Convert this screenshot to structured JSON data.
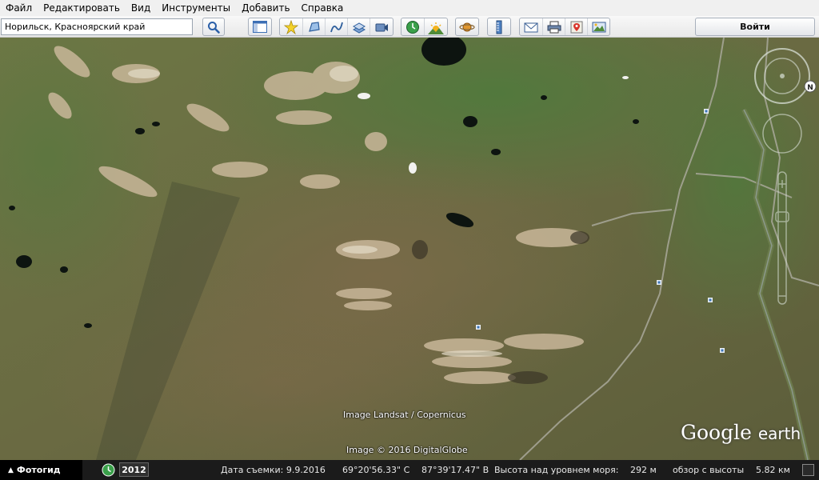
{
  "menu": {
    "items": [
      "Файл",
      "Редактировать",
      "Вид",
      "Инструменты",
      "Добавить",
      "Справка"
    ]
  },
  "toolbar": {
    "search_value": "Норильск, Красноярский край",
    "login_label": "Войти",
    "icons": [
      "search-icon",
      "sidebar-icon",
      "placemark-icon",
      "polygon-icon",
      "path-icon",
      "image-overlay-icon",
      "record-tour-icon",
      "historical-imagery-icon",
      "sunlight-icon",
      "planets-icon",
      "ruler-icon",
      "email-icon",
      "print-icon",
      "google-maps-icon",
      "save-image-icon"
    ]
  },
  "map": {
    "credit_landsat": "Image Landsat / Copernicus",
    "credit_globe": "Image © 2016 DigitalGlobe",
    "logo_main": "Google",
    "logo_small": "earth",
    "compass_letter": "N"
  },
  "status": {
    "photoguide_label": "Фотогид",
    "year": "2012",
    "date_label": "Дата съемки: 9.9.2016",
    "lat": "69°20'56.33\" С",
    "lon": "87°39'17.47\" В",
    "elevation_label": "Высота над уровнем моря:",
    "elevation_value": "292 м",
    "eye_alt_label": "обзор с высоты",
    "eye_alt_value": "5.82 км"
  }
}
